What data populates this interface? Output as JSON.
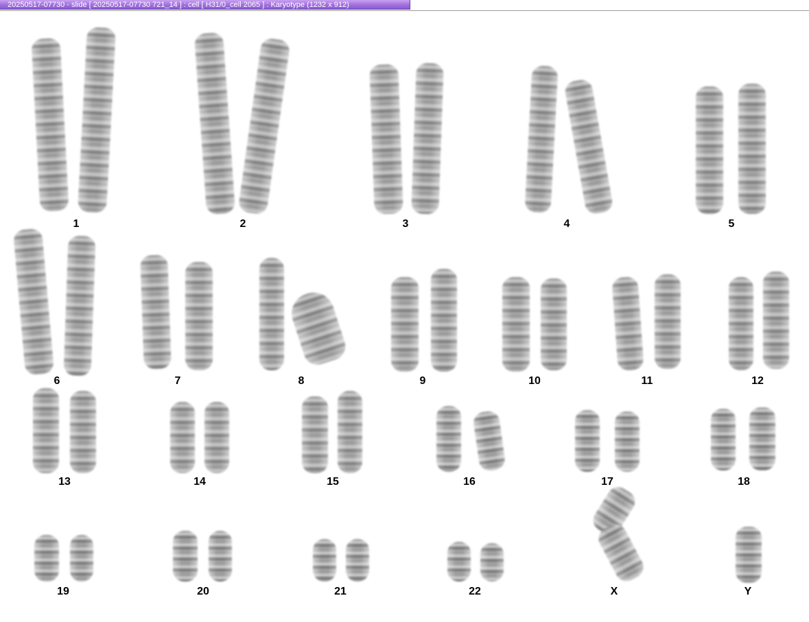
{
  "window": {
    "title": "20250517-07730 - slide [ 20250517-07730 721_14 ] : cell [ H31/0_cell 2065 ] : Karyotype  (1232 x 912)"
  },
  "colors": {
    "titlebar": "#a070de",
    "titlebar_text": "#ffffff",
    "background": "#ffffff",
    "label_text": "#000000"
  },
  "karyotype": {
    "labels": [
      "1",
      "2",
      "3",
      "4",
      "5",
      "6",
      "7",
      "8",
      "9",
      "10",
      "11",
      "12",
      "13",
      "14",
      "15",
      "16",
      "17",
      "18",
      "19",
      "20",
      "21",
      "22",
      "X",
      "Y"
    ]
  }
}
